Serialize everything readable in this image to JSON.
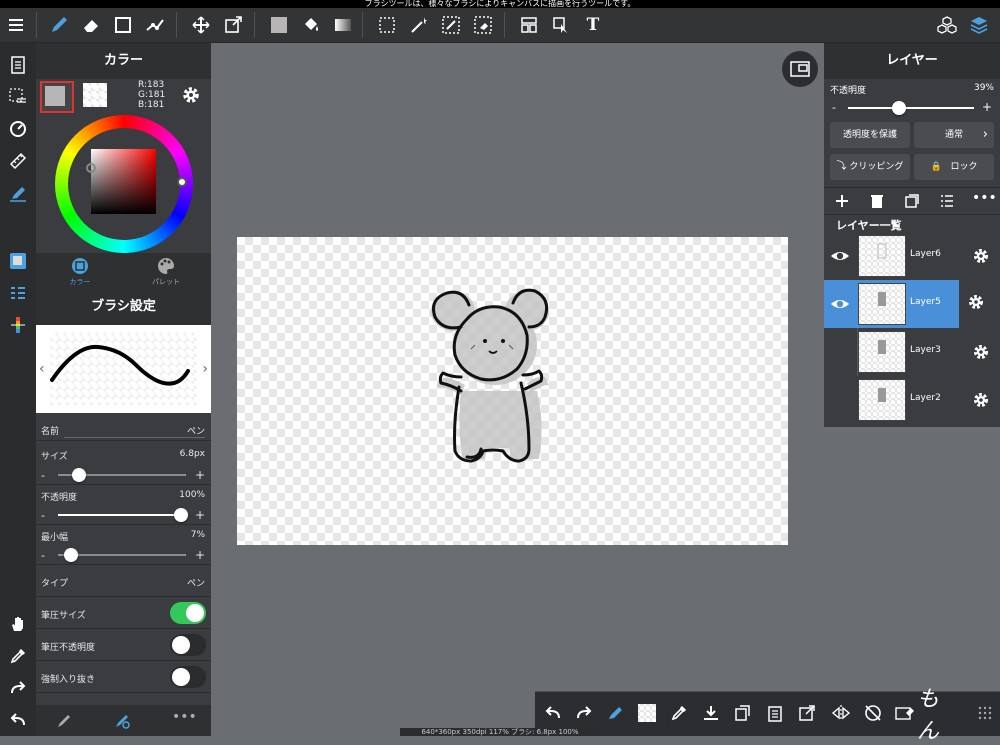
{
  "status_bar": {
    "text": "ブラシツールは、様々なブラシによりキャンバスに描画を行うツールです。"
  },
  "toolbar": {
    "text_tool_label": "T"
  },
  "color_panel": {
    "title": "カラー",
    "rgb": {
      "r": "R:183",
      "g": "G:181",
      "b": "B:181"
    },
    "tab_color": "カラー",
    "tab_palette": "パレット",
    "accent": "#4aa3df"
  },
  "brush_panel": {
    "title": "ブラシ設定",
    "name_label": "名前",
    "name_value": "ペン",
    "size_label": "サイズ",
    "size_value": "6.8px",
    "opacity_label": "不透明度",
    "opacity_value": "100%",
    "min_width_label": "最小幅",
    "min_width_value": "7%",
    "type_label": "タイプ",
    "type_value": "ペン",
    "pressure_size_label": "筆圧サイズ",
    "pressure_opacity_label": "筆圧不透明度",
    "force_fade_label": "強制入り抜き",
    "minus": "-",
    "plus": "+"
  },
  "layer_panel": {
    "title": "レイヤー",
    "opacity_label": "不透明度",
    "opacity_value": "39%",
    "protect_alpha": "透明度を保護",
    "blend_mode": "通常",
    "clipping": "クリッピング",
    "lock": "ロック",
    "list_title": "レイヤー一覧",
    "layers": [
      {
        "name": "Layer6",
        "visible": true,
        "selected": false
      },
      {
        "name": "Layer5",
        "visible": true,
        "selected": true
      },
      {
        "name": "Layer3",
        "visible": false,
        "selected": false
      },
      {
        "name": "Layer2",
        "visible": false,
        "selected": false
      }
    ],
    "minus": "-",
    "plus": "+"
  },
  "info_bar": {
    "text": "640*360px 350dpi 117% ブラシ: 6.8px 100%"
  },
  "signature": "もん"
}
